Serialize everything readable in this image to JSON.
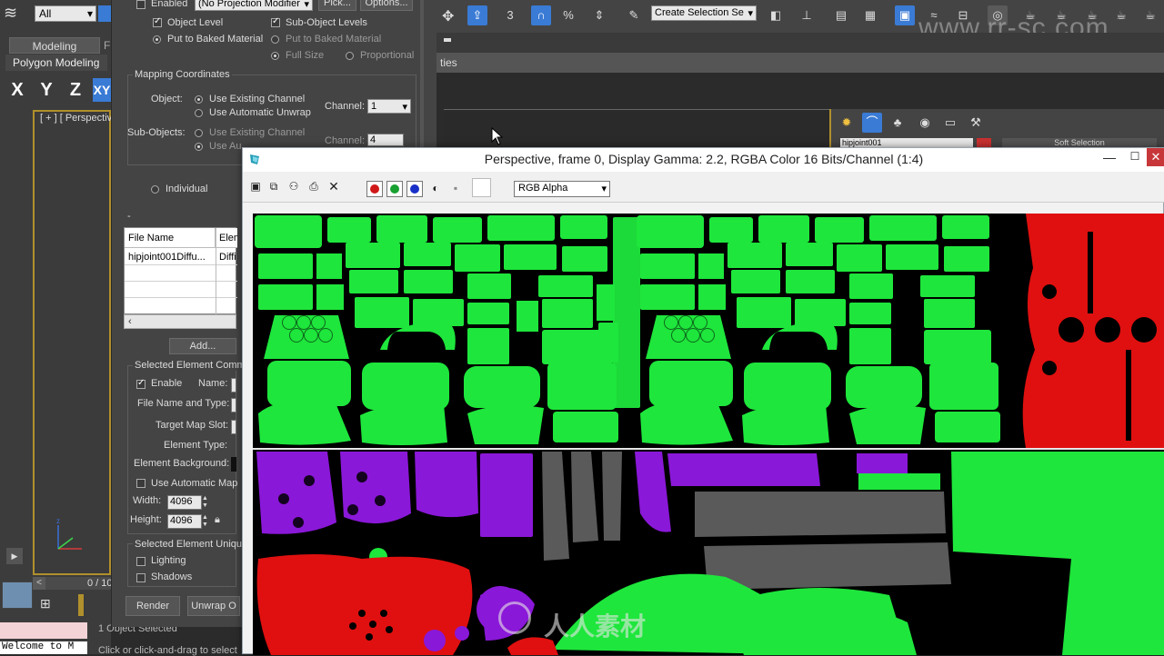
{
  "app": {
    "selection_filter": "All",
    "ribbon_tab": "Modeling",
    "ribbon_tab_next": "F",
    "ribbon_panel": "Polygon Modeling",
    "axes": [
      "X",
      "Y",
      "Z",
      "XY"
    ],
    "viewport_label": "[ + ] [ Perspective",
    "frame_readout": "0 / 10",
    "listener_text": "Welcome to M",
    "status_selection": "1 Object Selected",
    "status_prompt": "Click or click-and-drag to select",
    "selection_set_placeholder": "Create Selection Se",
    "command_panel_tab": "ties",
    "watermark_url": "www.rr-sc.com",
    "cmd_object_name": "hipjoint001",
    "cmd_soft_selection": "Soft Selection"
  },
  "rtt": {
    "enabled_label": "Enabled",
    "projection_combo": "(No Projection Modifier",
    "pick_label": "Pick...",
    "options_label": "Options...",
    "object_level": "Object Level",
    "sub_object_levels": "Sub-Object Levels",
    "put_to_baked_1": "Put to Baked Material",
    "put_to_baked_2": "Put to Baked Material",
    "full_size": "Full Size",
    "proportional": "Proportional",
    "mapping_title": "Mapping Coordinates",
    "object_label": "Object:",
    "use_existing_channel": "Use Existing Channel",
    "use_auto_unwrap": "Use Automatic Unwrap",
    "channel_label": "Channel:",
    "channel_value": "1",
    "sub_objects_label": "Sub-Objects:",
    "sub_use_existing": "Use Existing Channel",
    "sub_use_auto": "Use Au",
    "sub_channel_label": "Channel:",
    "sub_channel_value": "4",
    "individual_label": "Individual",
    "collapse_label": "-",
    "col_file_name": "File Name",
    "col_element": "Elem",
    "row_file": "hipjoint001Diffu...",
    "row_elem": "Diffi",
    "add_button": "Add...",
    "sel_elem_common": "Selected Element Comm",
    "enable_label": "Enable",
    "name_label": "Name:",
    "file_name_type": "File Name and Type:",
    "target_map_slot": "Target Map Slot:",
    "element_type": "Element Type:",
    "element_background": "Element Background:",
    "use_auto_map": "Use Automatic Map",
    "width_label": "Width:",
    "width_value": "4096",
    "height_label": "Height:",
    "height_value": "4096",
    "sel_elem_unique": "Selected Element Uniqu",
    "lighting": "Lighting",
    "shadows": "Shadows",
    "render_button": "Render",
    "unwrap_button": "Unwrap O"
  },
  "framebuffer": {
    "title": "Perspective, frame 0, Display Gamma: 2.2, RGBA Color 16 Bits/Channel (1:4)",
    "channel_display": "RGB Alpha",
    "minimize": "—",
    "maximize": "☐",
    "close": "✕"
  },
  "watermark": {
    "logo_text": "人人素材"
  },
  "colors": {
    "uv_green": "#1ee63c",
    "uv_red": "#e01010",
    "uv_purple": "#8a18d8",
    "uv_gray": "#5a5a5a",
    "accent_blue": "#3a7bd5",
    "viewport_border": "#b0902c"
  }
}
